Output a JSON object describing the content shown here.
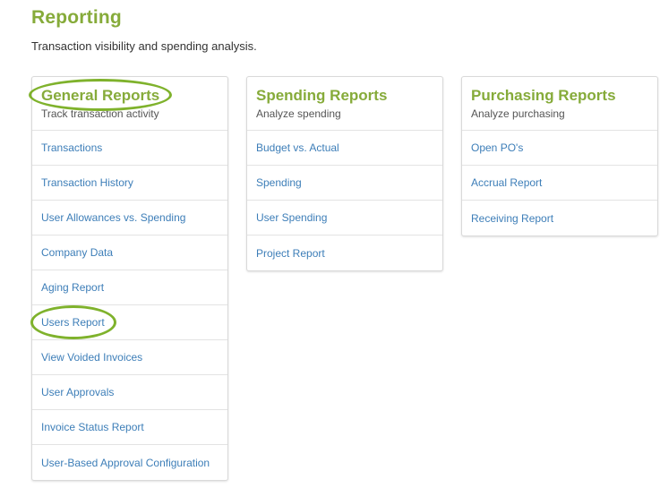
{
  "page": {
    "title": "Reporting",
    "subtitle": "Transaction visibility and spending analysis."
  },
  "colors": {
    "accent_green": "#86ab3a",
    "link_blue": "#3d7eb8",
    "highlight_ring": "#7fb22c"
  },
  "cards": {
    "general": {
      "title": "General Reports",
      "description": "Track transaction activity",
      "items": [
        "Transactions",
        "Transaction History",
        "User Allowances vs. Spending",
        "Company Data",
        "Aging Report",
        "Users Report",
        "View Voided Invoices",
        "User Approvals",
        "Invoice Status Report",
        "User-Based Approval Configuration"
      ]
    },
    "spending": {
      "title": "Spending Reports",
      "description": "Analyze spending",
      "items": [
        "Budget vs. Actual",
        "Spending",
        "User Spending",
        "Project Report"
      ]
    },
    "purchasing": {
      "title": "Purchasing Reports",
      "description": "Analyze purchasing",
      "items": [
        "Open PO's",
        "Accrual Report",
        "Receiving Report"
      ]
    }
  }
}
